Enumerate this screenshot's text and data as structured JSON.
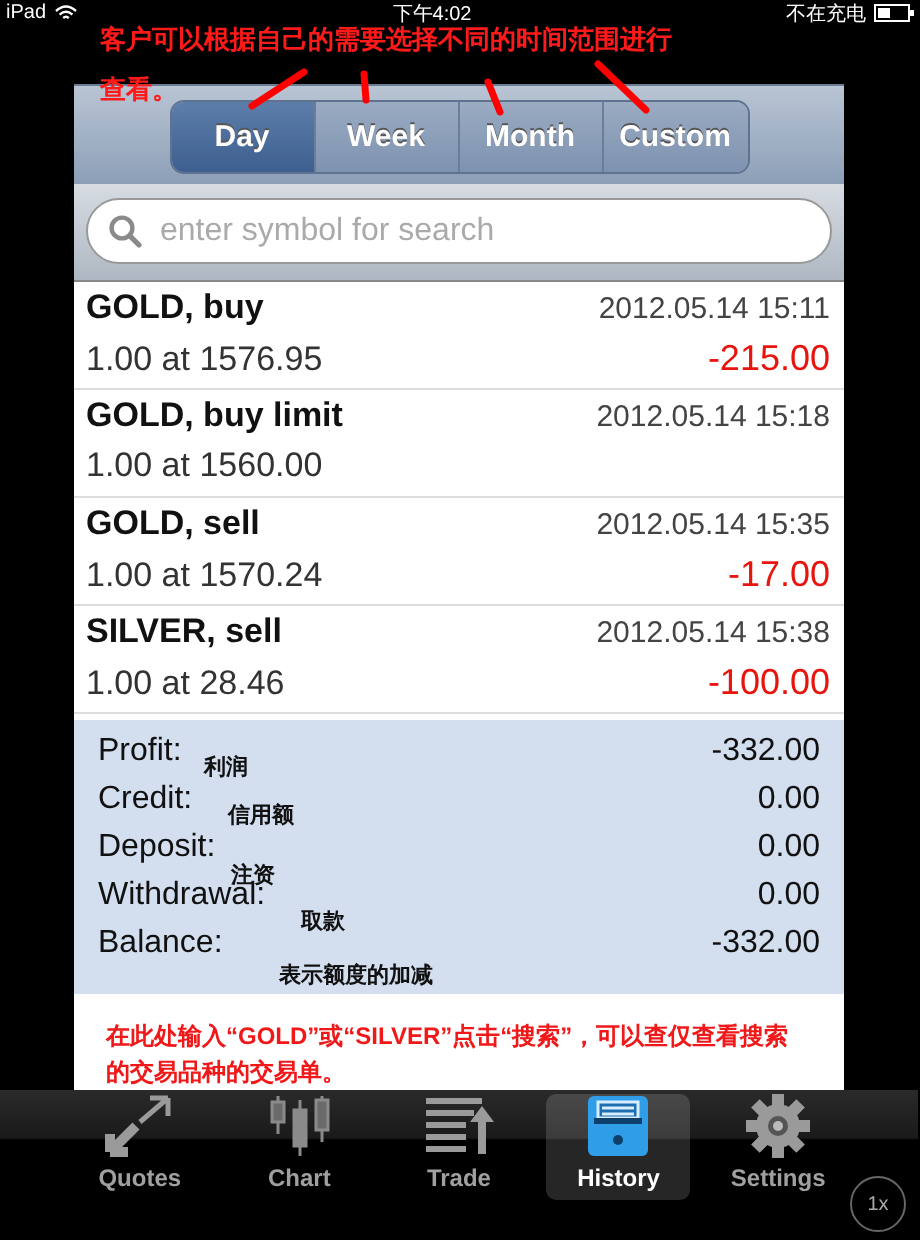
{
  "status_bar": {
    "device": "iPad",
    "time": "下午4:02",
    "battery_text": "不在充电"
  },
  "segments": {
    "annotation_lines": [
      "客户可以根据自己的需要选择不同的时间范围进行",
      "查看。"
    ],
    "items": [
      {
        "label": "Day",
        "selected": true
      },
      {
        "label": "Week",
        "selected": false
      },
      {
        "label": "Month",
        "selected": false
      },
      {
        "label": "Custom",
        "selected": false
      }
    ]
  },
  "search": {
    "placeholder": "enter symbol for search",
    "annotation": "在此处输入“GOLD”或“SILVER”点击“搜索”，可以查仅查看搜索的交易品种的交易单。"
  },
  "orders": [
    {
      "symbol": "GOLD, buy",
      "detail": "1.00 at 1576.95",
      "time": "2012.05.14 15:11",
      "profit": "-215.00"
    },
    {
      "symbol": "GOLD, buy limit",
      "detail": "1.00 at 1560.00",
      "time": "2012.05.14 15:18"
    },
    {
      "symbol": "GOLD, sell",
      "detail": "1.00 at 1570.24",
      "time": "2012.05.14 15:35",
      "profit": "-17.00"
    },
    {
      "symbol": "SILVER, sell",
      "detail": "1.00 at 28.46",
      "time": "2012.05.14 15:38",
      "profit": "-100.00"
    }
  ],
  "summary": [
    {
      "label": "Profit:",
      "value": "-332.00",
      "note": "利润"
    },
    {
      "label": "Credit:",
      "value": "0.00",
      "note": "信用额"
    },
    {
      "label": "Deposit:",
      "value": "0.00",
      "note": "注资"
    },
    {
      "label": "Withdrawal:",
      "value": "0.00",
      "note": "取款"
    },
    {
      "label": "Balance:",
      "value": "-332.00",
      "note": "表示额度的加减"
    }
  ],
  "tabs": [
    {
      "label": "Quotes",
      "selected": false
    },
    {
      "label": "Chart",
      "selected": false
    },
    {
      "label": "Trade",
      "selected": false
    },
    {
      "label": "History",
      "selected": true
    },
    {
      "label": "Settings",
      "selected": false
    }
  ],
  "zoom_button": "1x"
}
